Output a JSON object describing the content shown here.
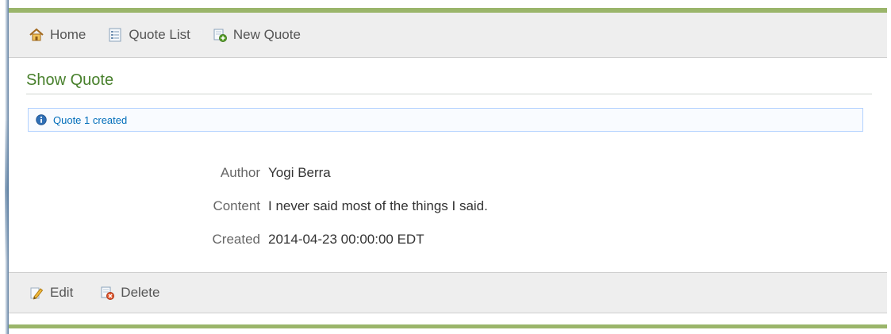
{
  "nav": {
    "home_label": "Home",
    "list_label": "Quote List",
    "create_label": "New Quote"
  },
  "page": {
    "title": "Show Quote"
  },
  "message": {
    "text": "Quote 1 created"
  },
  "quote": {
    "fields": [
      {
        "label": "Author",
        "value": "Yogi Berra"
      },
      {
        "label": "Content",
        "value": "I never said most of the things I said."
      },
      {
        "label": "Created",
        "value": "2014-04-23 00:00:00 EDT"
      }
    ]
  },
  "buttons": {
    "edit_label": "Edit",
    "delete_label": "Delete"
  },
  "colors": {
    "accent_green": "#9ab56a",
    "title_green": "#48802c",
    "message_blue": "#006dba",
    "message_border": "#b2d1ff"
  },
  "icons": {
    "home": "house-icon",
    "list": "document-list-icon",
    "create": "new-document-icon",
    "info": "info-icon",
    "edit": "pencil-icon",
    "delete": "delete-document-icon"
  }
}
